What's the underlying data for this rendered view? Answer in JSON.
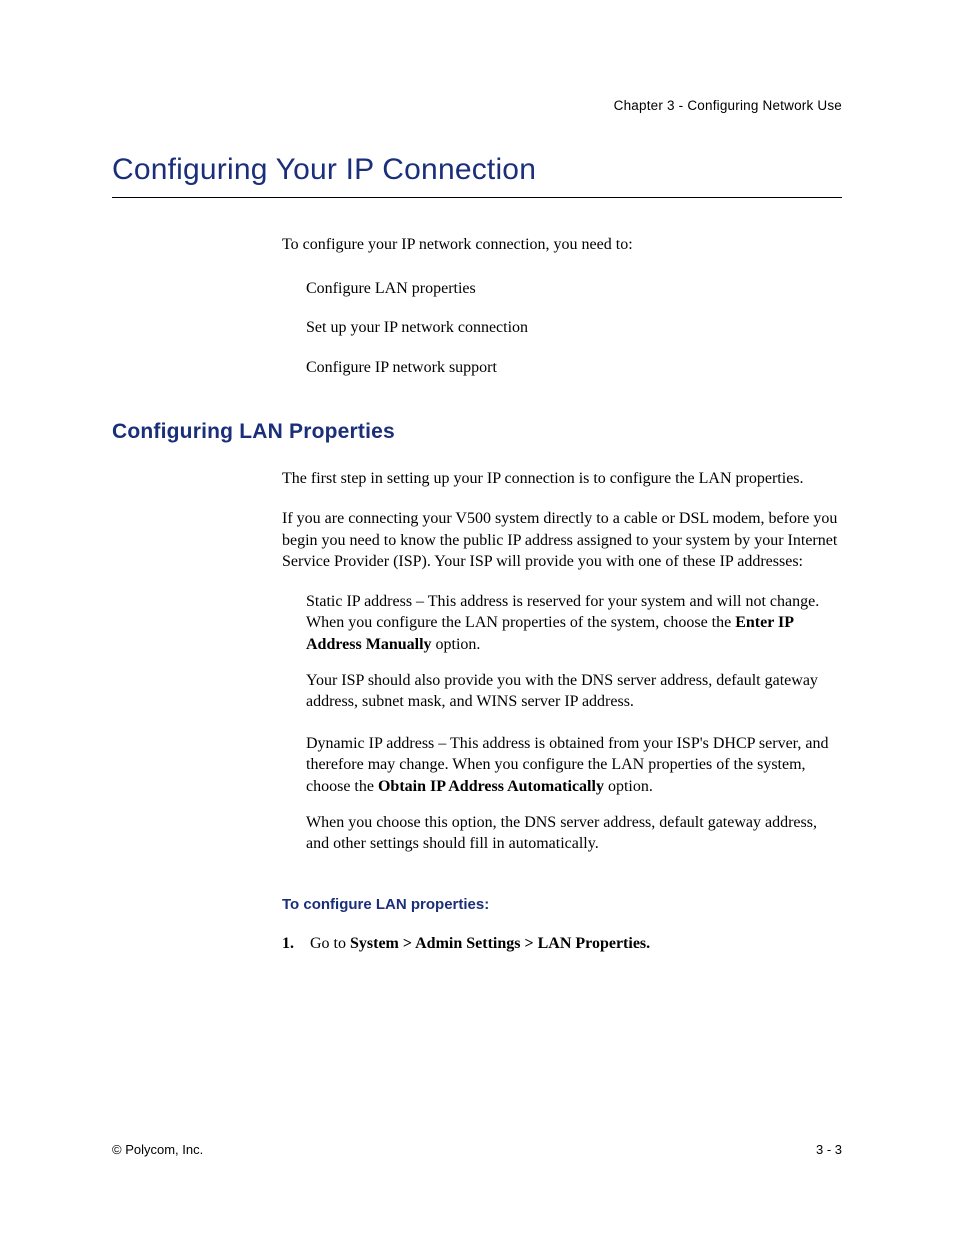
{
  "header": {
    "chapter_line": "Chapter 3 - Configuring Network Use"
  },
  "title": "Configuring Your IP Connection",
  "intro": "To configure your IP network connection, you need to:",
  "intro_bullets": [
    "Configure LAN properties",
    "Set up your IP network connection",
    "Configure IP network support"
  ],
  "section": {
    "title": "Configuring LAN Properties",
    "p1": "The first step in setting up your IP connection is to configure the LAN properties.",
    "p2": "If you are connecting your V500 system directly to a cable or DSL modem, before you begin you need to know the public IP address assigned to your system by your Internet Service Provider (ISP). Your ISP will provide you with one of these IP addresses:",
    "static_pre": "Static IP address – This address is reserved for your system and will not change. When you configure the LAN properties of the system, choose the ",
    "static_bold": "Enter IP Address Manually",
    "static_post": " option.",
    "static_p2": "Your ISP should also provide you with the DNS server address, default gateway address, subnet mask, and WINS server IP address.",
    "dynamic_pre": "Dynamic IP address – This address is obtained from your ISP's DHCP server, and therefore may change. When you configure the LAN properties of the system, choose the ",
    "dynamic_bold": "Obtain IP Address Automatically",
    "dynamic_post": " option.",
    "dynamic_p2": "When you choose this option, the DNS server address, default gateway address, and other settings should fill in automatically.",
    "procedure_title": "To configure LAN properties:",
    "step1_num": "1.",
    "step1_pre": "Go to ",
    "step1_bold": "System > Admin Settings > LAN Properties."
  },
  "footer": {
    "copyright": "© Polycom, Inc.",
    "page_num": "3 - 3"
  }
}
